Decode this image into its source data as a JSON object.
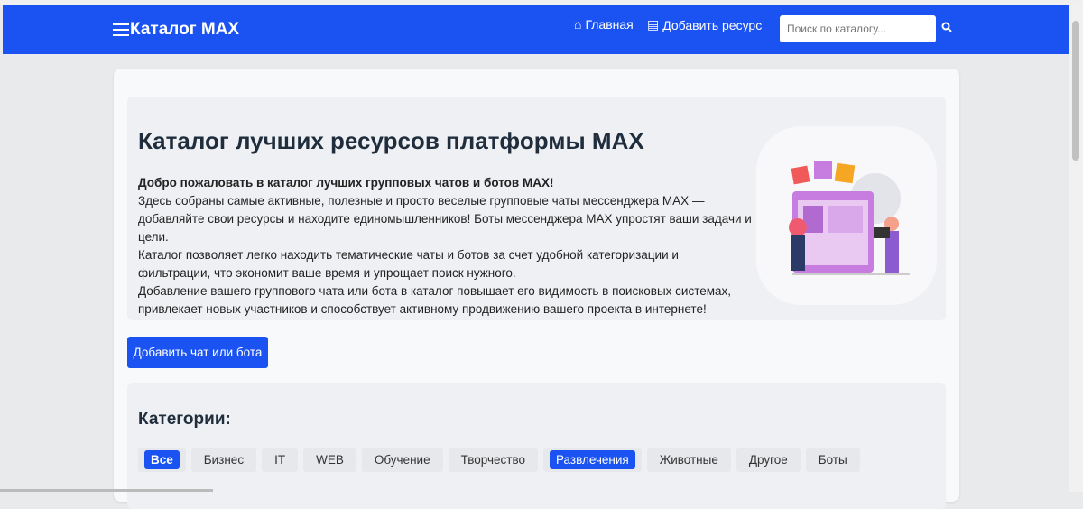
{
  "nav": {
    "brand": "Каталог MAX",
    "home": "Главная",
    "add_resource": "Добавить ресурс",
    "search_placeholder": "Поиск по каталогу..."
  },
  "hero": {
    "title": "Каталог лучших ресурсов платформы MAX",
    "lead": "Добро пожаловать в каталог лучших групповых чатов и ботов MAX!",
    "p1": "Здесь собраны самые активные, полезные и просто веселые групповые чаты мессенджера MAX — добавляйте свои ресурсы и находите единомышленников! Боты мессенджера MAX упростят ваши задачи и цели.",
    "p2": "Каталог позволяет легко находить тематические чаты и ботов за счет удобной категоризации и фильтрации, что экономит ваше время и упрощает поиск нужного.",
    "p3": "Добавление вашего группового чата или бота в каталог повышает его видимость в поисковых системах, привлекает новых участников и способствует активному продвижению вашего проекта в интернете!"
  },
  "add_button": "Добавить чат или бота",
  "categories": {
    "title": "Категории:",
    "items": [
      "Все",
      "Бизнес",
      "IT",
      "WEB",
      "Обучение",
      "Творчество",
      "Развлечения",
      "Животные",
      "Другое",
      "Боты"
    ]
  }
}
